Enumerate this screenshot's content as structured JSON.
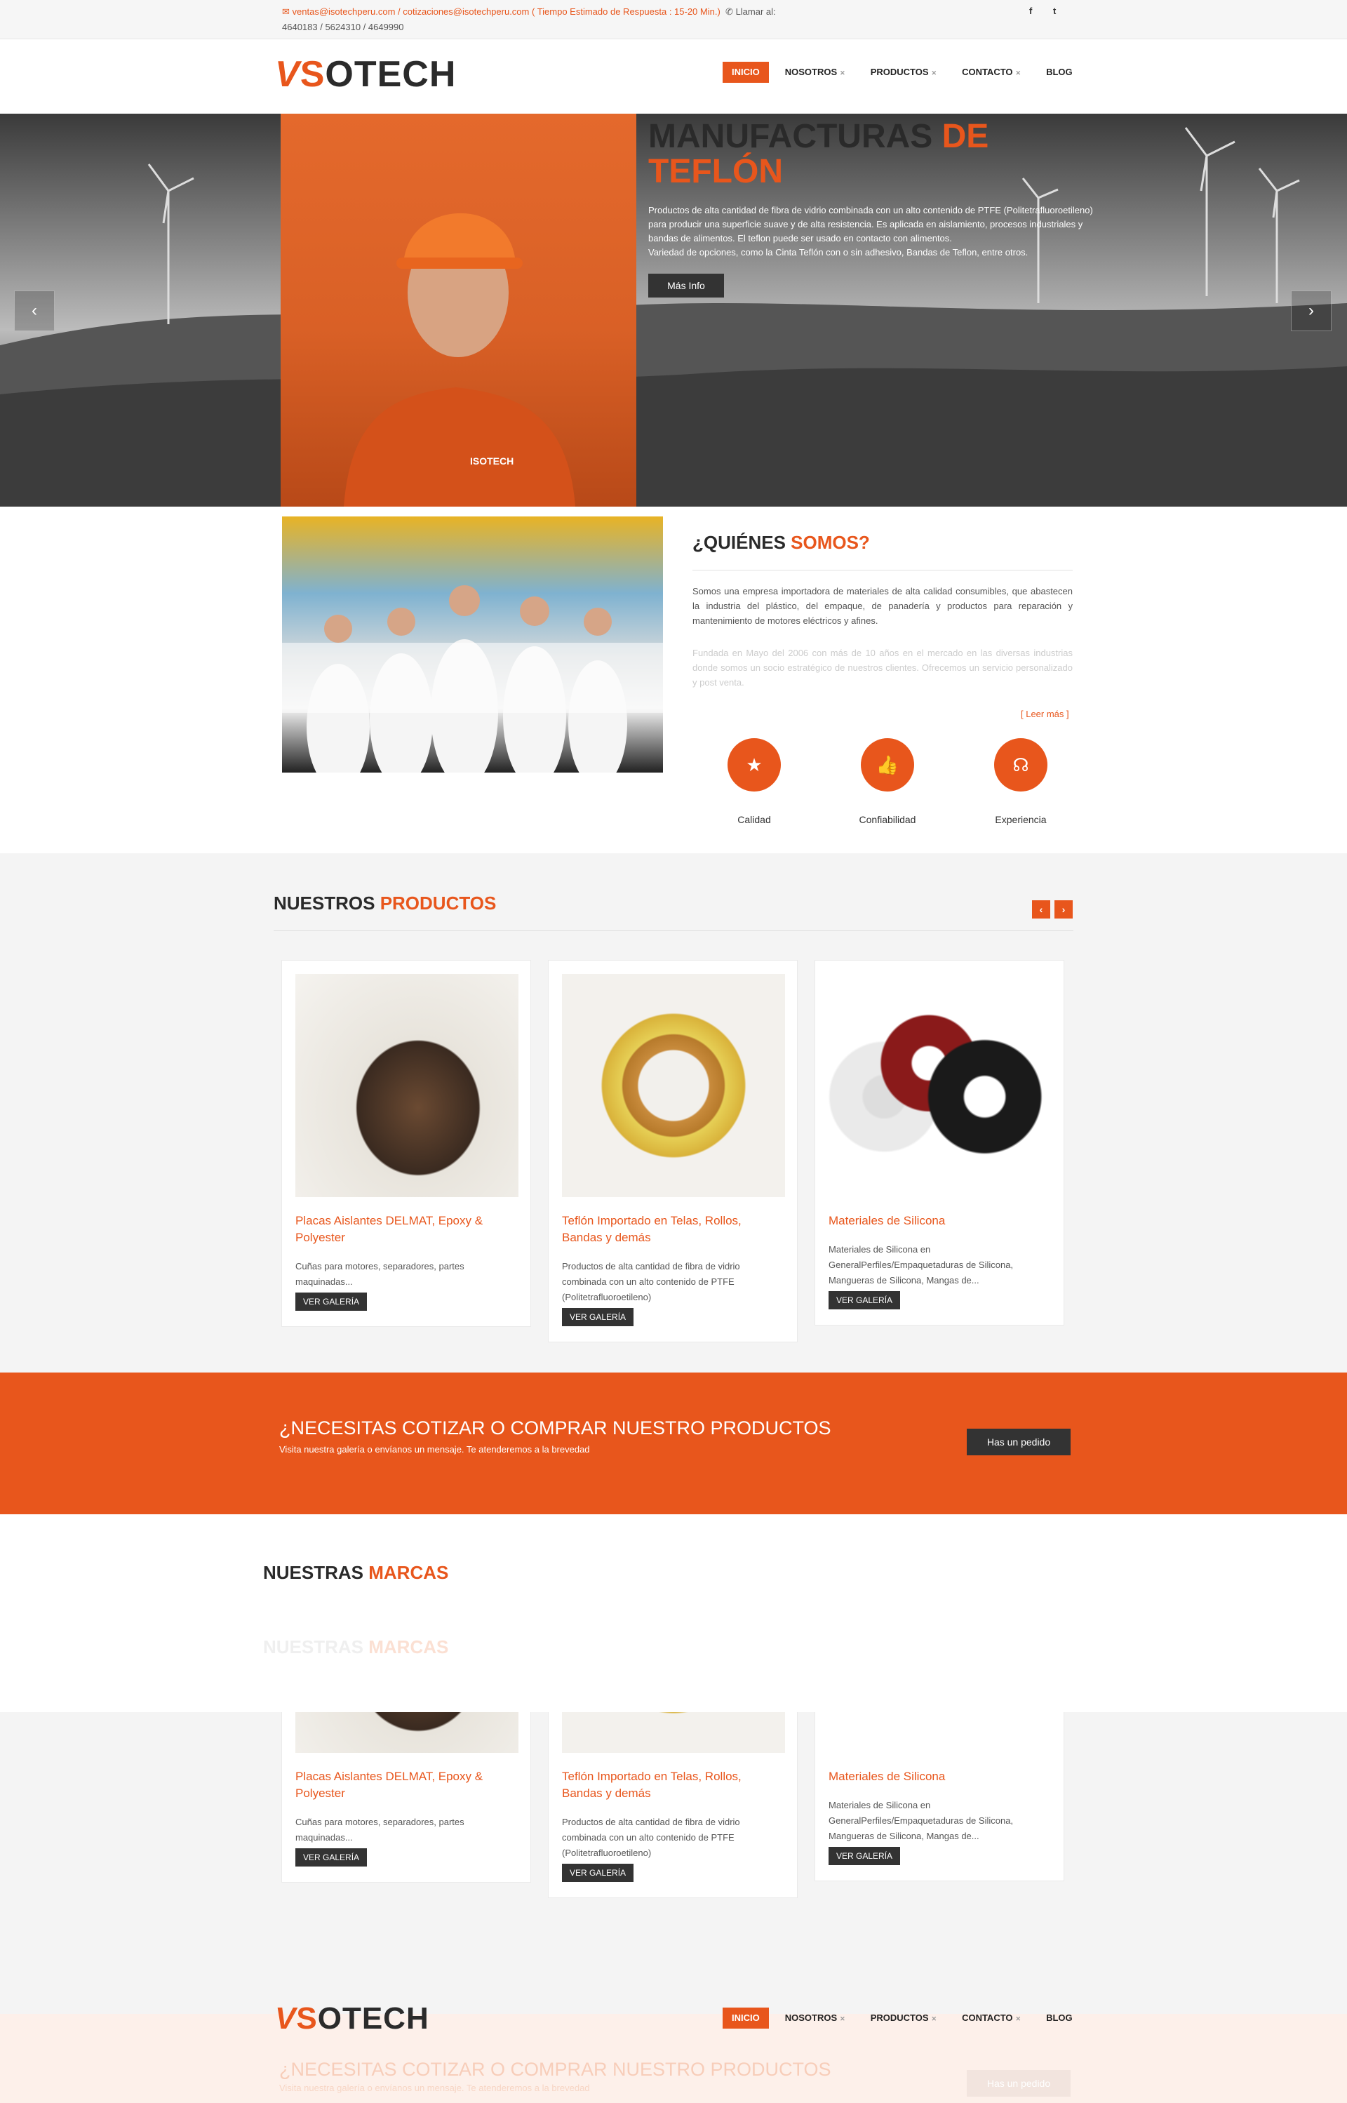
{
  "topbar": {
    "emails": "ventas@isotechperu.com / cotizaciones@isotechperu.com",
    "response_time": "( Tiempo Estimado de Respuesta : 15-20 Min.)",
    "call_label": "Llamar al:",
    "phones": "4640183 / 5624310 / 4649990",
    "social": [
      "f",
      "t"
    ]
  },
  "logo": {
    "v": "V",
    "s": "S",
    "rest": "OTECH",
    "alt": "ISOTECH"
  },
  "nav": {
    "items": [
      {
        "label": "INICIO",
        "active": true
      },
      {
        "label": "NOSOTROS",
        "has_sub": true
      },
      {
        "label": "PRODUCTOS",
        "has_sub": true
      },
      {
        "label": "CONTACTO",
        "has_sub": true
      },
      {
        "label": "BLOG"
      }
    ]
  },
  "hero": {
    "title_a": "MANUFACTURAS ",
    "title_b": "DE",
    "title_c": "TEFLÓN",
    "text": "Productos de alta cantidad de fibra de vidrio combinada con un alto contenido de PTFE (Politetrafluoroetileno) para producir una superficie suave y de alta resistencia. Es aplicada en aislamiento, procesos industriales y bandas de alimentos. El teflon puede ser usado en contacto con alimentos.",
    "text2": "Variedad de opciones, como la Cinta Teflón con o sin adhesivo, Bandas de Teflon, entre otros.",
    "button": "Más Info",
    "badge": "ISOTECH",
    "prev": "‹",
    "next": "›"
  },
  "about": {
    "title_a": "¿QUIÉNES ",
    "title_b": "SOMOS?",
    "text": "Somos una empresa importadora de materiales de alta calidad consumibles, que abastecen la industria del plástico, del empaque, de panadería y productos para reparación y mantenimiento de motores eléctricos y afines.",
    "text_faded": "Fundada en Mayo del 2006 con más de 10 años en el mercado en las diversas industrias donde somos un socio estratégico de nuestros clientes. Ofrecemos un servicio personalizado y post venta.",
    "read_more": "[ Leer más ]",
    "features": [
      {
        "label": "Calidad",
        "icon": "star-icon",
        "glyph": "★"
      },
      {
        "label": "Confiabilidad",
        "icon": "thumbs-up-icon",
        "glyph": "👍"
      },
      {
        "label": "Experiencia",
        "icon": "headset-icon",
        "glyph": "☊"
      }
    ]
  },
  "products": {
    "title_a": "NUESTROS ",
    "title_b": "PRODUCTOS",
    "prev": "‹",
    "next": "›",
    "items": [
      {
        "title": "Placas Aislantes DELMAT, Epoxy & Polyester",
        "desc": "Cuñas para motores, separadores, partes maquinadas...",
        "button": "VER GALERÍA"
      },
      {
        "title": "Teflón Importado en Telas, Rollos, Bandas y demás",
        "desc": "Productos de alta cantidad de fibra de vidrio combinada con un alto contenido de PTFE (Politetrafluoroetileno)",
        "button": "VER GALERÍA"
      },
      {
        "title": "Materiales de Silicona",
        "desc": "Materiales de Silicona en GeneralPerfiles/Empaquetaduras de Silicona, Mangueras de Silicona, Mangas de...",
        "button": "VER GALERÍA"
      }
    ]
  },
  "cta": {
    "title": "¿NECESITAS COTIZAR O COMPRAR NUESTRO PRODUCTOS",
    "subtitle": "Visita nuestra galería o envíanos un mensaje. Te atenderemos a la brevedad",
    "button": "Has un pedido"
  },
  "brands": {
    "title_a": "NUESTRAS ",
    "title_b": "MARCAS"
  },
  "colors": {
    "accent": "#e8561c",
    "dark": "#333333"
  }
}
